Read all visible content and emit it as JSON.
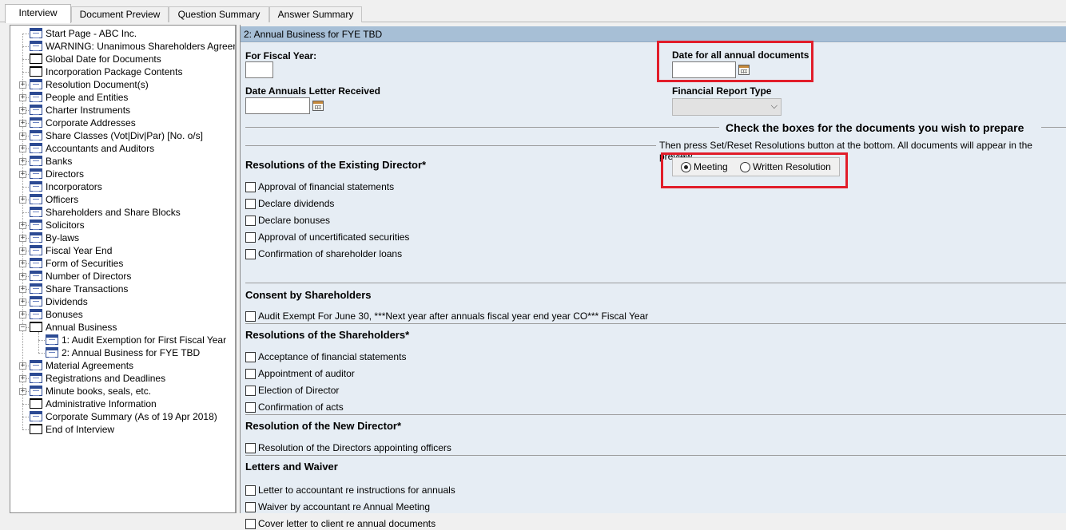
{
  "tabs": [
    {
      "label": "Interview",
      "active": true
    },
    {
      "label": "Document Preview",
      "active": false
    },
    {
      "label": "Question Summary",
      "active": false
    },
    {
      "label": "Answer Summary",
      "active": false
    }
  ],
  "tree": {
    "items": [
      {
        "label": "Start Page - ABC Inc.",
        "expandable": false,
        "icon": "document-icon"
      },
      {
        "label": "WARNING: Unanimous Shareholders Agreem",
        "expandable": false,
        "icon": "document-icon"
      },
      {
        "label": "Global Date for Documents",
        "expandable": false,
        "icon": "blank-page-icon"
      },
      {
        "label": "Incorporation Package Contents",
        "expandable": false,
        "icon": "blank-page-icon"
      },
      {
        "label": "Resolution Document(s)",
        "expandable": true,
        "icon": "document-icon"
      },
      {
        "label": "People and Entities",
        "expandable": true,
        "icon": "document-icon"
      },
      {
        "label": "Charter Instruments",
        "expandable": true,
        "icon": "document-icon"
      },
      {
        "label": "Corporate Addresses",
        "expandable": true,
        "icon": "document-icon"
      },
      {
        "label": "Share Classes (Vot|Div|Par) [No. o/s]",
        "expandable": true,
        "icon": "document-icon"
      },
      {
        "label": "Accountants and Auditors",
        "expandable": true,
        "icon": "document-icon"
      },
      {
        "label": "Banks",
        "expandable": true,
        "icon": "document-icon"
      },
      {
        "label": "Directors",
        "expandable": true,
        "icon": "document-icon"
      },
      {
        "label": "Incorporators",
        "expandable": false,
        "icon": "document-icon"
      },
      {
        "label": "Officers",
        "expandable": true,
        "icon": "document-icon"
      },
      {
        "label": "Shareholders and Share Blocks",
        "expandable": false,
        "icon": "document-icon"
      },
      {
        "label": "Solicitors",
        "expandable": true,
        "icon": "document-icon"
      },
      {
        "label": "By-laws",
        "expandable": true,
        "icon": "document-icon"
      },
      {
        "label": "Fiscal Year End",
        "expandable": true,
        "icon": "document-icon"
      },
      {
        "label": "Form of Securities",
        "expandable": true,
        "icon": "document-icon"
      },
      {
        "label": "Number of Directors",
        "expandable": true,
        "icon": "document-icon"
      },
      {
        "label": "Share Transactions",
        "expandable": true,
        "icon": "document-icon"
      },
      {
        "label": "Dividends",
        "expandable": true,
        "icon": "document-icon"
      },
      {
        "label": "Bonuses",
        "expandable": true,
        "icon": "document-icon"
      },
      {
        "label": "Annual Business",
        "expandable": true,
        "expanded": true,
        "icon": "blank-page-icon"
      },
      {
        "label": "1: Audit Exemption for First Fiscal Year",
        "child": true,
        "icon": "document-icon"
      },
      {
        "label": "2: Annual Business for FYE TBD",
        "child": true,
        "icon": "document-icon",
        "selected": true
      },
      {
        "label": "Material Agreements",
        "expandable": true,
        "icon": "document-icon"
      },
      {
        "label": "Registrations and Deadlines",
        "expandable": true,
        "icon": "document-icon"
      },
      {
        "label": "Minute books, seals, etc.",
        "expandable": true,
        "icon": "document-icon"
      },
      {
        "label": "Administrative Information",
        "expandable": false,
        "icon": "blank-page-icon"
      },
      {
        "label": "Corporate Summary (As of 19 Apr 2018)",
        "expandable": false,
        "icon": "document-icon"
      },
      {
        "label": "End of Interview",
        "expandable": false,
        "icon": "blank-page-icon"
      }
    ]
  },
  "panel": {
    "header": "2: Annual Business for FYE TBD",
    "fiscal_year_label": "For Fiscal Year:",
    "fiscal_year_value": "",
    "date_all_label": "Date for all annual documents",
    "date_all_value": "",
    "date_letter_label": "Date Annuals Letter Received",
    "date_letter_value": "",
    "financial_report_label": "Financial Report Type",
    "financial_report_value": "",
    "check_title": "Check the boxes for the documents you wish to prepare",
    "check_subtitle": "Then press Set/Reset Resolutions button at the bottom. All documents will appear in the preview",
    "meeting_options": [
      {
        "label": "Meeting",
        "selected": true
      },
      {
        "label": "Written Resolution",
        "selected": false
      }
    ],
    "sections": [
      {
        "title": "Resolutions of the Existing Director*",
        "items": [
          "Approval of financial statements",
          "Declare dividends",
          "Declare bonuses",
          "Approval of uncertificated securities",
          "Confirmation of shareholder loans"
        ]
      },
      {
        "title": "Consent by Shareholders",
        "items": [
          "Audit Exempt For June 30, ***Next year after annuals fiscal year end year CO*** Fiscal Year"
        ]
      },
      {
        "title": "Resolutions of the Shareholders*",
        "items": [
          "Acceptance of financial statements",
          "Appointment of auditor",
          "Election of Director",
          "Confirmation of acts"
        ]
      },
      {
        "title": "Resolution of the New Director*",
        "items": [
          "Resolution of the Directors appointing officers"
        ]
      },
      {
        "title": "Letters and Waiver",
        "items": [
          "Letter to accountant re instructions for annuals",
          "Waiver by accountant re Annual Meeting",
          "Cover letter to client re annual documents"
        ]
      }
    ]
  },
  "colors": {
    "header_bg": "#a7bfd6",
    "panel_bg": "#e6edf4",
    "highlight": "#e11d2a",
    "tree_icon": "#2c4a93"
  }
}
